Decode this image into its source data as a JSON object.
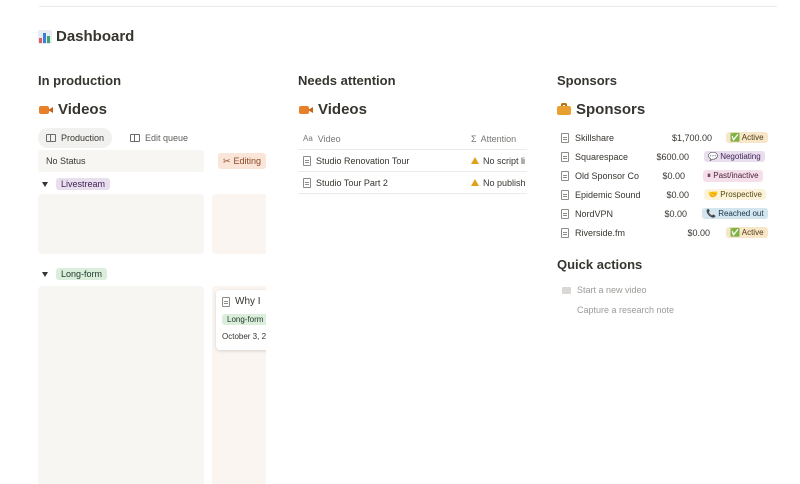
{
  "page": {
    "title": "Dashboard",
    "title_icon": "bar-chart-icon"
  },
  "in_production": {
    "heading": "In production",
    "db_title": "Videos",
    "tabs": [
      {
        "label": "Production",
        "icon": "table-icon",
        "active": true
      },
      {
        "label": "Edit queue",
        "icon": "table-icon",
        "active": false
      }
    ],
    "status_columns": [
      "No Status",
      "Editing"
    ],
    "editing_icon": "scissors-icon",
    "groups": [
      {
        "label": "Livestream"
      },
      {
        "label": "Long-form"
      }
    ],
    "card": {
      "title": "Why I",
      "tag": "Long-form",
      "date": "October 3, 2"
    }
  },
  "needs_attention": {
    "heading": "Needs attention",
    "db_title": "Videos",
    "columns": [
      "Video",
      "Attention"
    ],
    "rows": [
      {
        "video": "Studio Renovation Tour",
        "attention": "No script li"
      },
      {
        "video": "Studio Tour Part 2",
        "attention": "No publish"
      }
    ]
  },
  "sponsors": {
    "heading": "Sponsors",
    "db_title": "Sponsors",
    "rows": [
      {
        "name": "Skillshare",
        "amount": "$1,700.00",
        "status": "Active",
        "status_icon": "✅"
      },
      {
        "name": "Squarespace",
        "amount": "$600.00",
        "status": "Negotiating",
        "status_icon": "💬"
      },
      {
        "name": "Old Sponsor Co",
        "amount": "$0.00",
        "status": "Past/inactive",
        "status_icon": "⏸"
      },
      {
        "name": "Epidemic Sound",
        "amount": "$0.00",
        "status": "Prospective",
        "status_icon": "🤝"
      },
      {
        "name": "NordVPN",
        "amount": "$0.00",
        "status": "Reached out",
        "status_icon": "📞"
      },
      {
        "name": "Riverside.fm",
        "amount": "$0.00",
        "status": "Active",
        "status_icon": "✅"
      }
    ]
  },
  "quick_actions": {
    "heading": "Quick actions",
    "items": [
      {
        "label": "Start a new video"
      },
      {
        "label": "Capture a research note"
      }
    ]
  },
  "colors": {
    "text": "#37352f",
    "muted": "#787774",
    "lane_bg": "#f7f6f3"
  }
}
